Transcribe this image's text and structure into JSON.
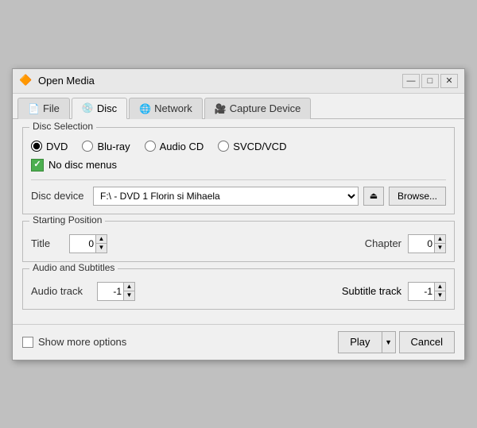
{
  "window": {
    "title": "Open Media",
    "icon": "🔶",
    "min_btn": "—",
    "max_btn": "□",
    "close_btn": "✕"
  },
  "tabs": [
    {
      "id": "file",
      "label": "File",
      "icon": "📄",
      "active": false
    },
    {
      "id": "disc",
      "label": "Disc",
      "icon": "💿",
      "active": true
    },
    {
      "id": "network",
      "label": "Network",
      "icon": "🌐",
      "active": false
    },
    {
      "id": "capture",
      "label": "Capture Device",
      "icon": "🎥",
      "active": false
    }
  ],
  "disc_selection": {
    "group_title": "Disc Selection",
    "radio_options": [
      {
        "id": "dvd",
        "label": "DVD",
        "checked": true
      },
      {
        "id": "bluray",
        "label": "Blu-ray",
        "checked": false
      },
      {
        "id": "audiocd",
        "label": "Audio CD",
        "checked": false
      },
      {
        "id": "svcd",
        "label": "SVCD/VCD",
        "checked": false
      }
    ],
    "no_disc_menus_label": "No disc menus",
    "no_disc_menus_checked": true,
    "device_label": "Disc device",
    "device_value": "F:\\ - DVD 1 Florin si Mihaela",
    "eject_icon": "⏏",
    "browse_label": "Browse..."
  },
  "starting_position": {
    "group_title": "Starting Position",
    "title_label": "Title",
    "title_value": "0",
    "chapter_label": "Chapter",
    "chapter_value": "0"
  },
  "audio_subtitles": {
    "group_title": "Audio and Subtitles",
    "audio_track_label": "Audio track",
    "audio_track_value": "-1",
    "subtitle_track_label": "Subtitle track",
    "subtitle_track_value": "-1"
  },
  "bottom": {
    "show_more_label": "Show more options",
    "play_label": "Play",
    "cancel_label": "Cancel",
    "dropdown_arrow": "▼"
  }
}
